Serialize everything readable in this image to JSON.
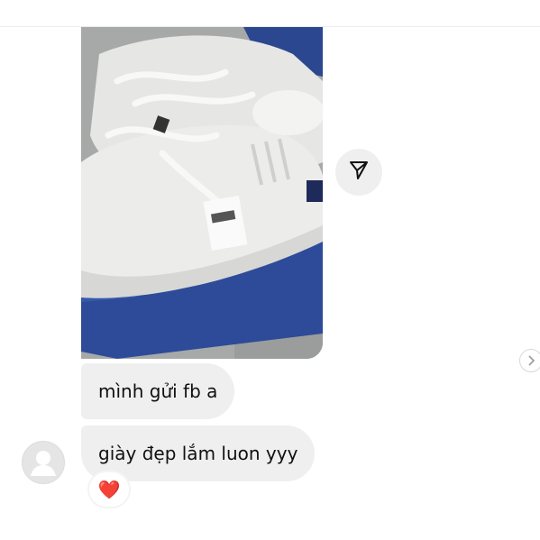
{
  "chat": {
    "messages": [
      {
        "sender": "other",
        "text": "mình gửi fb a"
      },
      {
        "sender": "other",
        "text": "giày đẹp lắm luon yyy"
      }
    ],
    "reaction": {
      "emoji": "❤️"
    }
  },
  "icons": {
    "share": "share-paper-plane-icon",
    "next": "chevron-right-icon",
    "avatar": "default-avatar-icon"
  },
  "colors": {
    "bubble": "#efefef",
    "reaction_heart": "#e0182a",
    "box_blue": "#2d4b98"
  }
}
